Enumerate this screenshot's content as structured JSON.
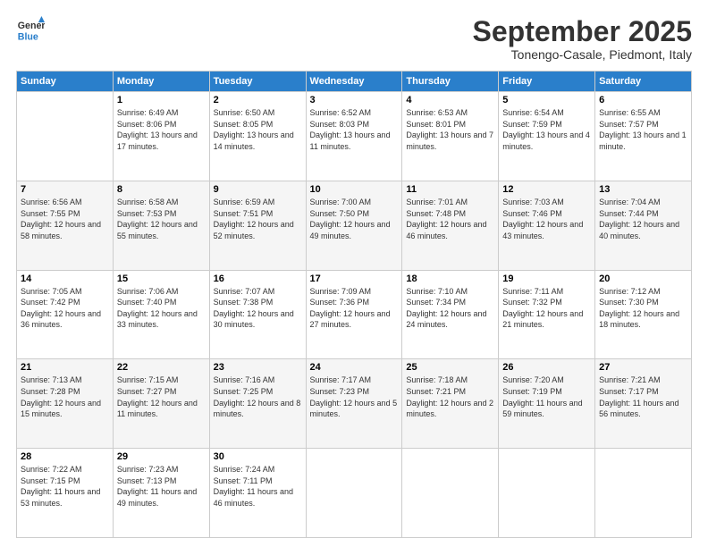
{
  "logo": {
    "line1": "General",
    "line2": "Blue"
  },
  "header": {
    "title": "September 2025",
    "location": "Tonengo-Casale, Piedmont, Italy"
  },
  "days_of_week": [
    "Sunday",
    "Monday",
    "Tuesday",
    "Wednesday",
    "Thursday",
    "Friday",
    "Saturday"
  ],
  "weeks": [
    [
      null,
      {
        "num": "1",
        "sunrise": "6:49 AM",
        "sunset": "8:06 PM",
        "daylight": "13 hours and 17 minutes."
      },
      {
        "num": "2",
        "sunrise": "6:50 AM",
        "sunset": "8:05 PM",
        "daylight": "13 hours and 14 minutes."
      },
      {
        "num": "3",
        "sunrise": "6:52 AM",
        "sunset": "8:03 PM",
        "daylight": "13 hours and 11 minutes."
      },
      {
        "num": "4",
        "sunrise": "6:53 AM",
        "sunset": "8:01 PM",
        "daylight": "13 hours and 7 minutes."
      },
      {
        "num": "5",
        "sunrise": "6:54 AM",
        "sunset": "7:59 PM",
        "daylight": "13 hours and 4 minutes."
      },
      {
        "num": "6",
        "sunrise": "6:55 AM",
        "sunset": "7:57 PM",
        "daylight": "13 hours and 1 minute."
      }
    ],
    [
      {
        "num": "7",
        "sunrise": "6:56 AM",
        "sunset": "7:55 PM",
        "daylight": "12 hours and 58 minutes."
      },
      {
        "num": "8",
        "sunrise": "6:58 AM",
        "sunset": "7:53 PM",
        "daylight": "12 hours and 55 minutes."
      },
      {
        "num": "9",
        "sunrise": "6:59 AM",
        "sunset": "7:51 PM",
        "daylight": "12 hours and 52 minutes."
      },
      {
        "num": "10",
        "sunrise": "7:00 AM",
        "sunset": "7:50 PM",
        "daylight": "12 hours and 49 minutes."
      },
      {
        "num": "11",
        "sunrise": "7:01 AM",
        "sunset": "7:48 PM",
        "daylight": "12 hours and 46 minutes."
      },
      {
        "num": "12",
        "sunrise": "7:03 AM",
        "sunset": "7:46 PM",
        "daylight": "12 hours and 43 minutes."
      },
      {
        "num": "13",
        "sunrise": "7:04 AM",
        "sunset": "7:44 PM",
        "daylight": "12 hours and 40 minutes."
      }
    ],
    [
      {
        "num": "14",
        "sunrise": "7:05 AM",
        "sunset": "7:42 PM",
        "daylight": "12 hours and 36 minutes."
      },
      {
        "num": "15",
        "sunrise": "7:06 AM",
        "sunset": "7:40 PM",
        "daylight": "12 hours and 33 minutes."
      },
      {
        "num": "16",
        "sunrise": "7:07 AM",
        "sunset": "7:38 PM",
        "daylight": "12 hours and 30 minutes."
      },
      {
        "num": "17",
        "sunrise": "7:09 AM",
        "sunset": "7:36 PM",
        "daylight": "12 hours and 27 minutes."
      },
      {
        "num": "18",
        "sunrise": "7:10 AM",
        "sunset": "7:34 PM",
        "daylight": "12 hours and 24 minutes."
      },
      {
        "num": "19",
        "sunrise": "7:11 AM",
        "sunset": "7:32 PM",
        "daylight": "12 hours and 21 minutes."
      },
      {
        "num": "20",
        "sunrise": "7:12 AM",
        "sunset": "7:30 PM",
        "daylight": "12 hours and 18 minutes."
      }
    ],
    [
      {
        "num": "21",
        "sunrise": "7:13 AM",
        "sunset": "7:28 PM",
        "daylight": "12 hours and 15 minutes."
      },
      {
        "num": "22",
        "sunrise": "7:15 AM",
        "sunset": "7:27 PM",
        "daylight": "12 hours and 11 minutes."
      },
      {
        "num": "23",
        "sunrise": "7:16 AM",
        "sunset": "7:25 PM",
        "daylight": "12 hours and 8 minutes."
      },
      {
        "num": "24",
        "sunrise": "7:17 AM",
        "sunset": "7:23 PM",
        "daylight": "12 hours and 5 minutes."
      },
      {
        "num": "25",
        "sunrise": "7:18 AM",
        "sunset": "7:21 PM",
        "daylight": "12 hours and 2 minutes."
      },
      {
        "num": "26",
        "sunrise": "7:20 AM",
        "sunset": "7:19 PM",
        "daylight": "11 hours and 59 minutes."
      },
      {
        "num": "27",
        "sunrise": "7:21 AM",
        "sunset": "7:17 PM",
        "daylight": "11 hours and 56 minutes."
      }
    ],
    [
      {
        "num": "28",
        "sunrise": "7:22 AM",
        "sunset": "7:15 PM",
        "daylight": "11 hours and 53 minutes."
      },
      {
        "num": "29",
        "sunrise": "7:23 AM",
        "sunset": "7:13 PM",
        "daylight": "11 hours and 49 minutes."
      },
      {
        "num": "30",
        "sunrise": "7:24 AM",
        "sunset": "7:11 PM",
        "daylight": "11 hours and 46 minutes."
      },
      null,
      null,
      null,
      null
    ]
  ]
}
